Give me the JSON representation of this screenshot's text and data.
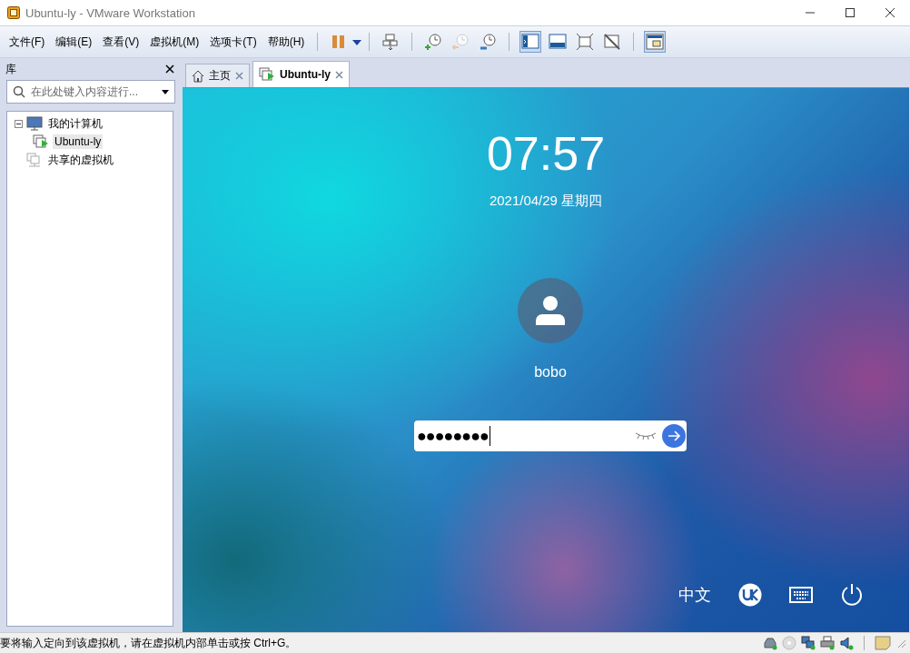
{
  "window": {
    "title": "Ubuntu-ly - VMware Workstation"
  },
  "menu": [
    "文件(F)",
    "编辑(E)",
    "查看(V)",
    "虚拟机(M)",
    "选项卡(T)",
    "帮助(H)"
  ],
  "toolbar": [
    {
      "kind": "pause",
      "on": false
    },
    {
      "kind": "send-keys",
      "on": false
    },
    {
      "kind": "snapshot-take",
      "on": false
    },
    {
      "kind": "snapshot-revert",
      "on": false,
      "disabled": true
    },
    {
      "kind": "snapshot-manager",
      "on": false
    },
    {
      "kind": "library",
      "on": true
    },
    {
      "kind": "thumbnail",
      "on": false
    },
    {
      "kind": "fullscreen",
      "on": false
    },
    {
      "kind": "unity",
      "on": false
    },
    {
      "kind": "console",
      "on": true
    }
  ],
  "library": {
    "title": "库",
    "search": {
      "placeholder": "在此处键入内容进行..."
    },
    "tree": [
      {
        "label": "我的计算机",
        "kind": "computer",
        "expanded": true,
        "selected": false,
        "children": [
          {
            "label": "Ubuntu-ly",
            "kind": "vm",
            "selected": true
          }
        ]
      },
      {
        "label": "共享的虚拟机",
        "kind": "shared",
        "selected": false
      }
    ]
  },
  "tabs": [
    {
      "label": "主页",
      "kind": "home",
      "selected": false
    },
    {
      "label": "Ubuntu-ly",
      "kind": "vm",
      "selected": true
    }
  ],
  "login": {
    "time": "07:57",
    "date": "2021/04/29 星期四",
    "user": "bobo",
    "password": "●●●●●●●●",
    "language": "中文"
  },
  "status_bar": {
    "text": "要将输入定向到该虚拟机，请在虚拟机内部单击或按 Ctrl+G。"
  }
}
